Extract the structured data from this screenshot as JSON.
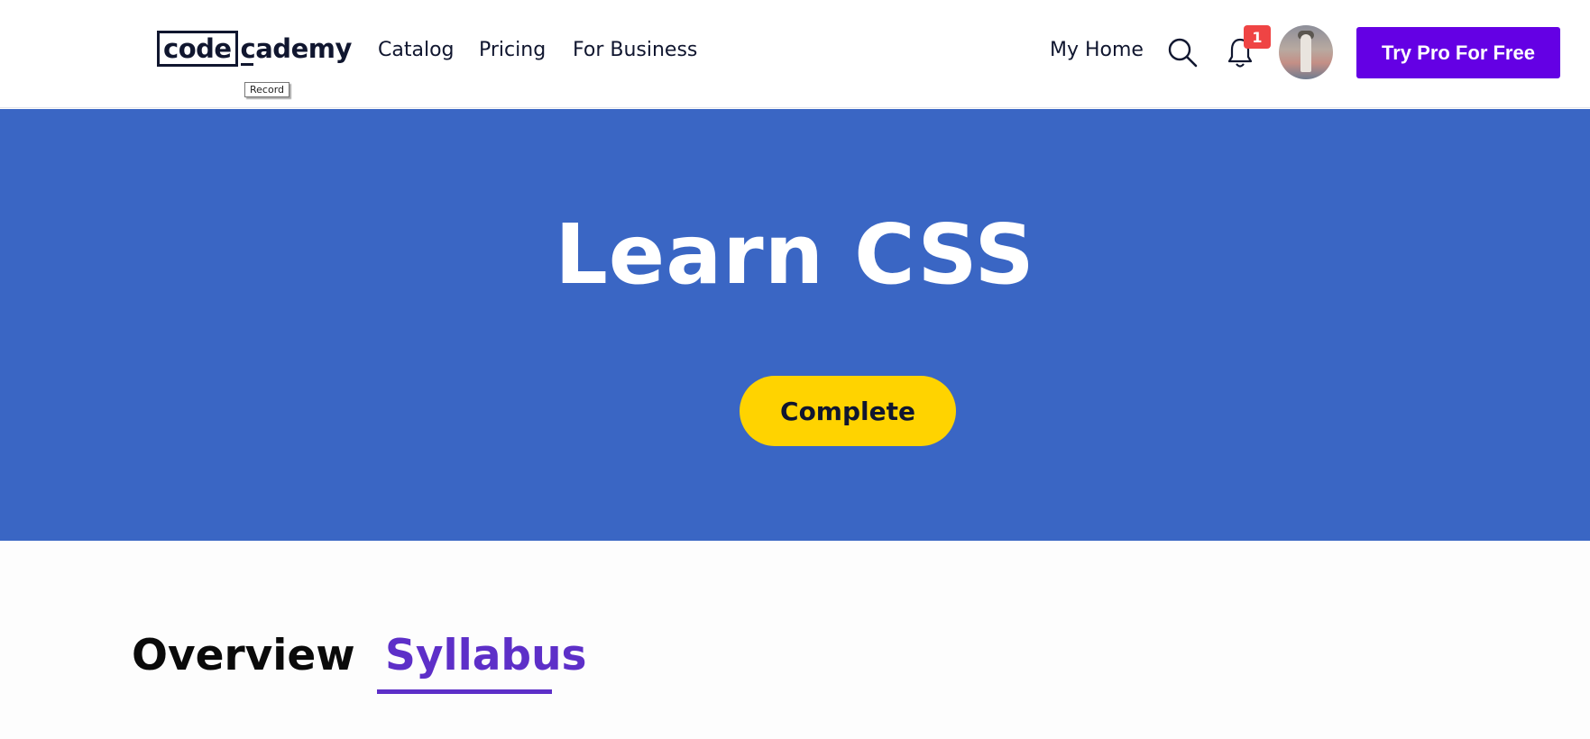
{
  "header": {
    "logo_part1": "code",
    "logo_part2": "cademy",
    "tooltip": "Record",
    "nav": {
      "catalog": "Catalog",
      "pricing": "Pricing",
      "business": "For Business",
      "home": "My Home"
    },
    "notifications_count": "1",
    "cta": "Try Pro For Free"
  },
  "hero": {
    "title": "Learn CSS",
    "status_button": "Complete"
  },
  "tabs": {
    "overview": "Overview",
    "syllabus": "Syllabus",
    "active": "Syllabus"
  },
  "colors": {
    "brand_purple": "#6400e4",
    "hero_blue": "#3a66c4",
    "complete_yellow": "#ffd300",
    "badge_red": "#ef4444",
    "tab_active": "#5d2fc8"
  },
  "icons": [
    "search-icon",
    "bell-icon"
  ]
}
